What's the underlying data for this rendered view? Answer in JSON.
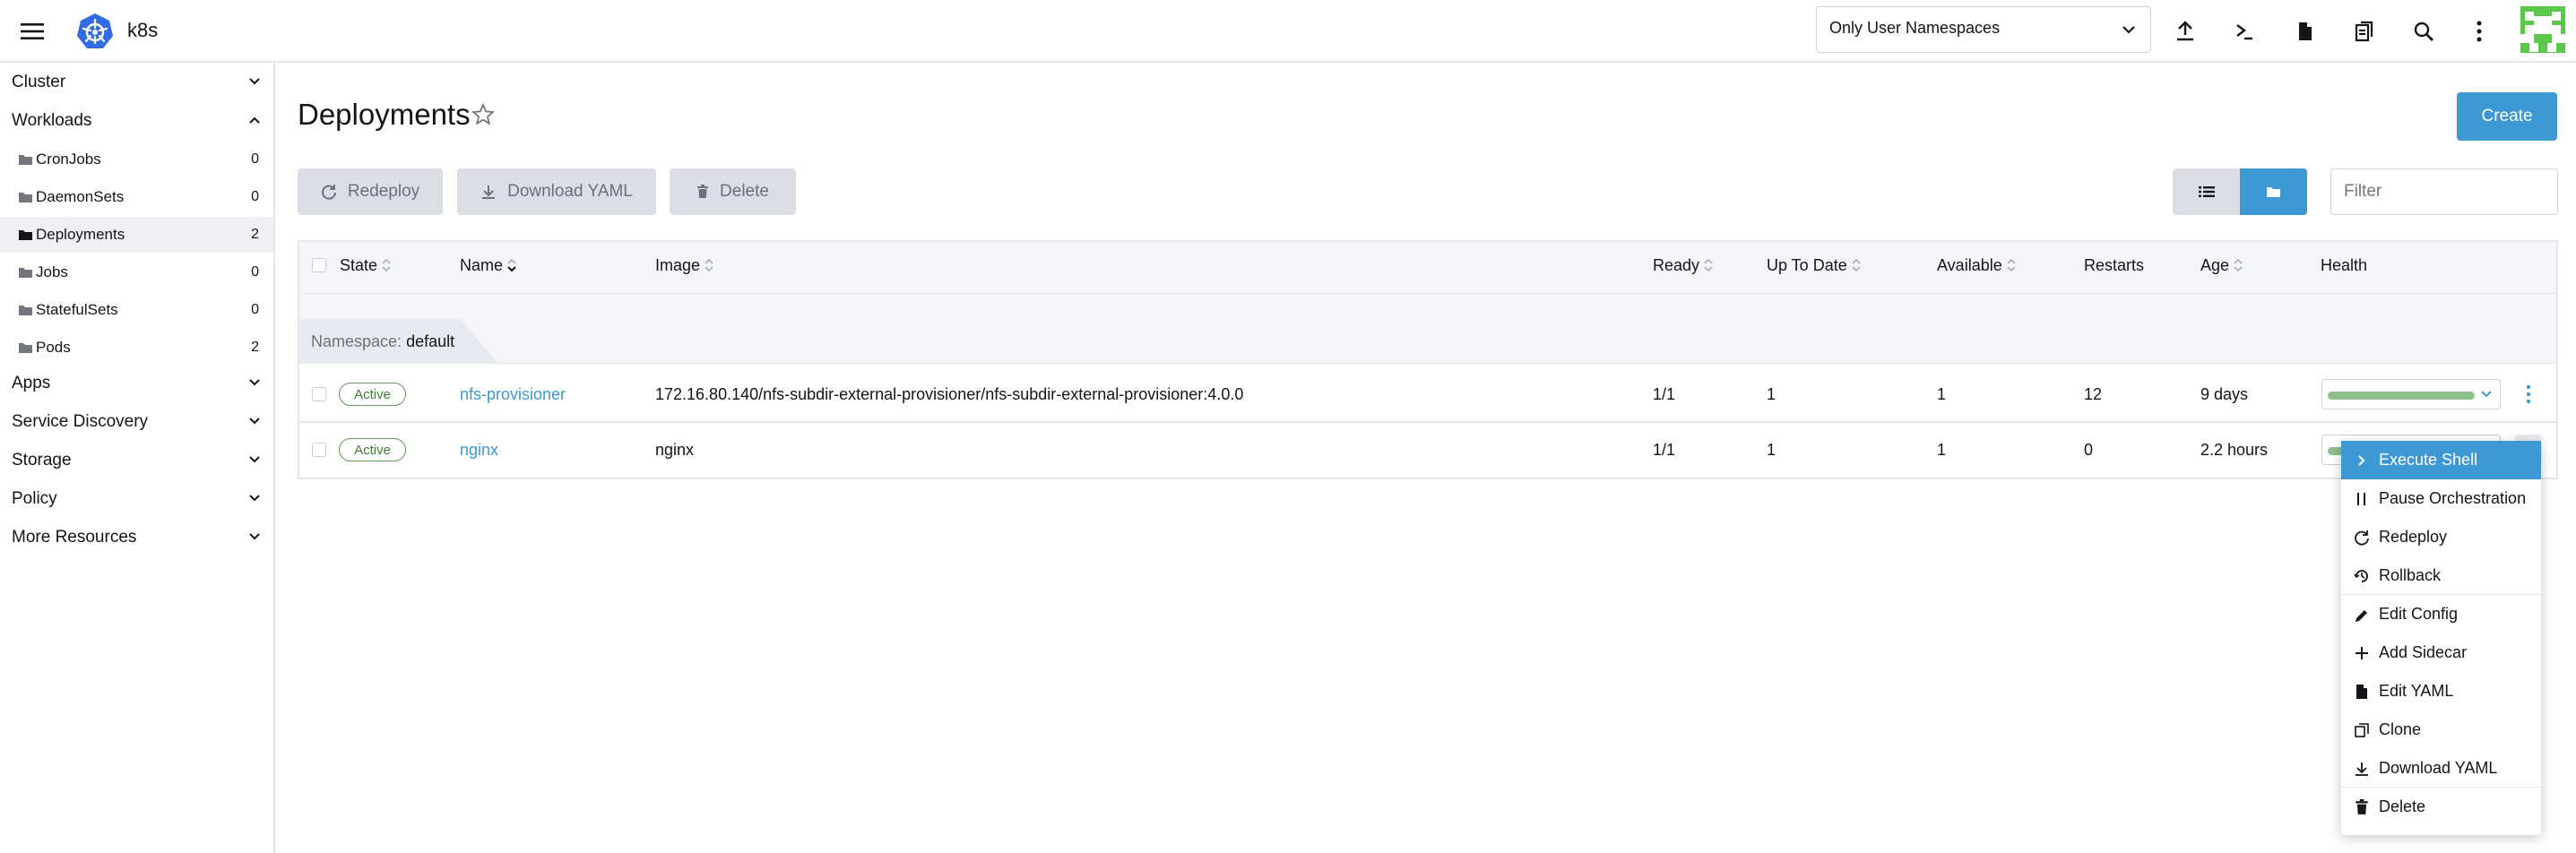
{
  "header": {
    "cluster_name": "k8s",
    "namespace_select": "Only User Namespaces"
  },
  "sidebar": {
    "groups": [
      {
        "label": "Cluster"
      },
      {
        "label": "Workloads"
      },
      {
        "label": "Apps"
      },
      {
        "label": "Service Discovery"
      },
      {
        "label": "Storage"
      },
      {
        "label": "Policy"
      },
      {
        "label": "More Resources"
      }
    ],
    "workloads": [
      {
        "label": "CronJobs",
        "count": "0"
      },
      {
        "label": "DaemonSets",
        "count": "0"
      },
      {
        "label": "Deployments",
        "count": "2"
      },
      {
        "label": "Jobs",
        "count": "0"
      },
      {
        "label": "StatefulSets",
        "count": "0"
      },
      {
        "label": "Pods",
        "count": "2"
      }
    ]
  },
  "page": {
    "title": "Deployments",
    "create_label": "Create",
    "redeploy_label": "Redeploy",
    "download_yaml_label": "Download YAML",
    "delete_label": "Delete",
    "filter_placeholder": "Filter"
  },
  "table": {
    "columns": [
      "State",
      "Name",
      "Image",
      "Ready",
      "Up To Date",
      "Available",
      "Restarts",
      "Age",
      "Health"
    ],
    "group_prefix": "Namespace:",
    "group_name": "default",
    "rows": [
      {
        "state": "Active",
        "name": "nfs-provisioner",
        "image": "172.16.80.140/nfs-subdir-external-provisioner/nfs-subdir-external-provisioner:4.0.0",
        "ready": "1/1",
        "up_to_date": "1",
        "available": "1",
        "restarts": "12",
        "age": "9 days",
        "health": 1.0
      },
      {
        "state": "Active",
        "name": "nginx",
        "image": "nginx",
        "ready": "1/1",
        "up_to_date": "1",
        "available": "1",
        "restarts": "0",
        "age": "2.2 hours",
        "health": 1.0
      }
    ]
  },
  "context_menu": {
    "items": [
      {
        "label": "Execute Shell",
        "icon": "chevron-right-icon"
      },
      {
        "label": "Pause Orchestration",
        "icon": "pause-icon"
      },
      {
        "label": "Redeploy",
        "icon": "refresh-icon"
      },
      {
        "label": "Rollback",
        "icon": "history-icon"
      },
      {
        "label": "Edit Config",
        "icon": "pencil-icon"
      },
      {
        "label": "Add Sidecar",
        "icon": "plus-icon"
      },
      {
        "label": "Edit YAML",
        "icon": "file-icon"
      },
      {
        "label": "Clone",
        "icon": "copy-icon"
      },
      {
        "label": "Download YAML",
        "icon": "download-icon"
      },
      {
        "label": "Delete",
        "icon": "trash-icon"
      }
    ]
  },
  "colors": {
    "accent": "#3d98d3",
    "active_badge": "#5f9a55",
    "health_bar": "#8fbf8a",
    "avatar": "#5ac84b"
  }
}
